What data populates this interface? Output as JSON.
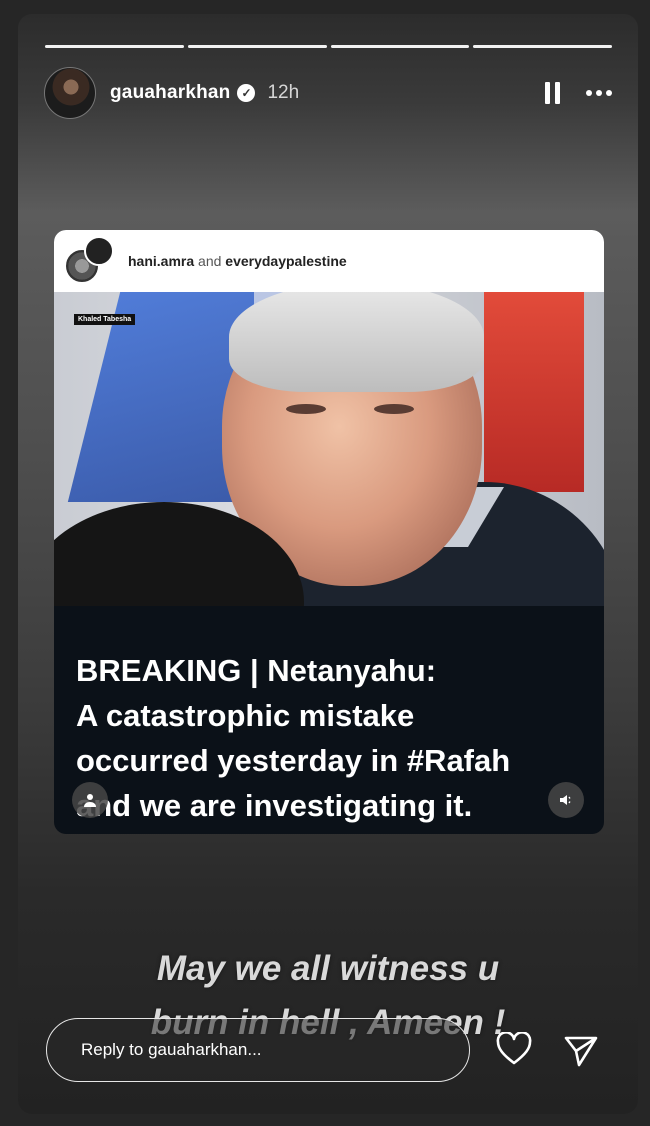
{
  "story": {
    "progress_segments": 4,
    "progress_active_index": 3,
    "user": {
      "username": "gauaharkhan",
      "verified": true,
      "time_ago": "12h"
    },
    "header_icons": [
      "pause-icon",
      "more-options-icon"
    ]
  },
  "shared_post": {
    "credits_user1": "hani.amra",
    "credits_and": "and",
    "credits_user2": "everydaypalestine",
    "photo_tag": "Khaled Tabesha",
    "headline_lines": [
      "BREAKING | Netanyahu:",
      "A catastrophic mistake",
      "occurred yesterday in #Rafah",
      "and we are investigating it."
    ],
    "icons": [
      "tagged-user-icon",
      "mute-icon"
    ]
  },
  "overlay_text": {
    "line1": "May we all witness u",
    "line2": "burn in hell , Ameen !"
  },
  "reply": {
    "placeholder": "Reply to gauaharkhan..."
  },
  "colors": {
    "background": "#262626",
    "text": "#ffffff",
    "headline_panel": "#0b1118",
    "flag_blue": "#2f5cc7",
    "flag_red": "#d63a2f"
  }
}
